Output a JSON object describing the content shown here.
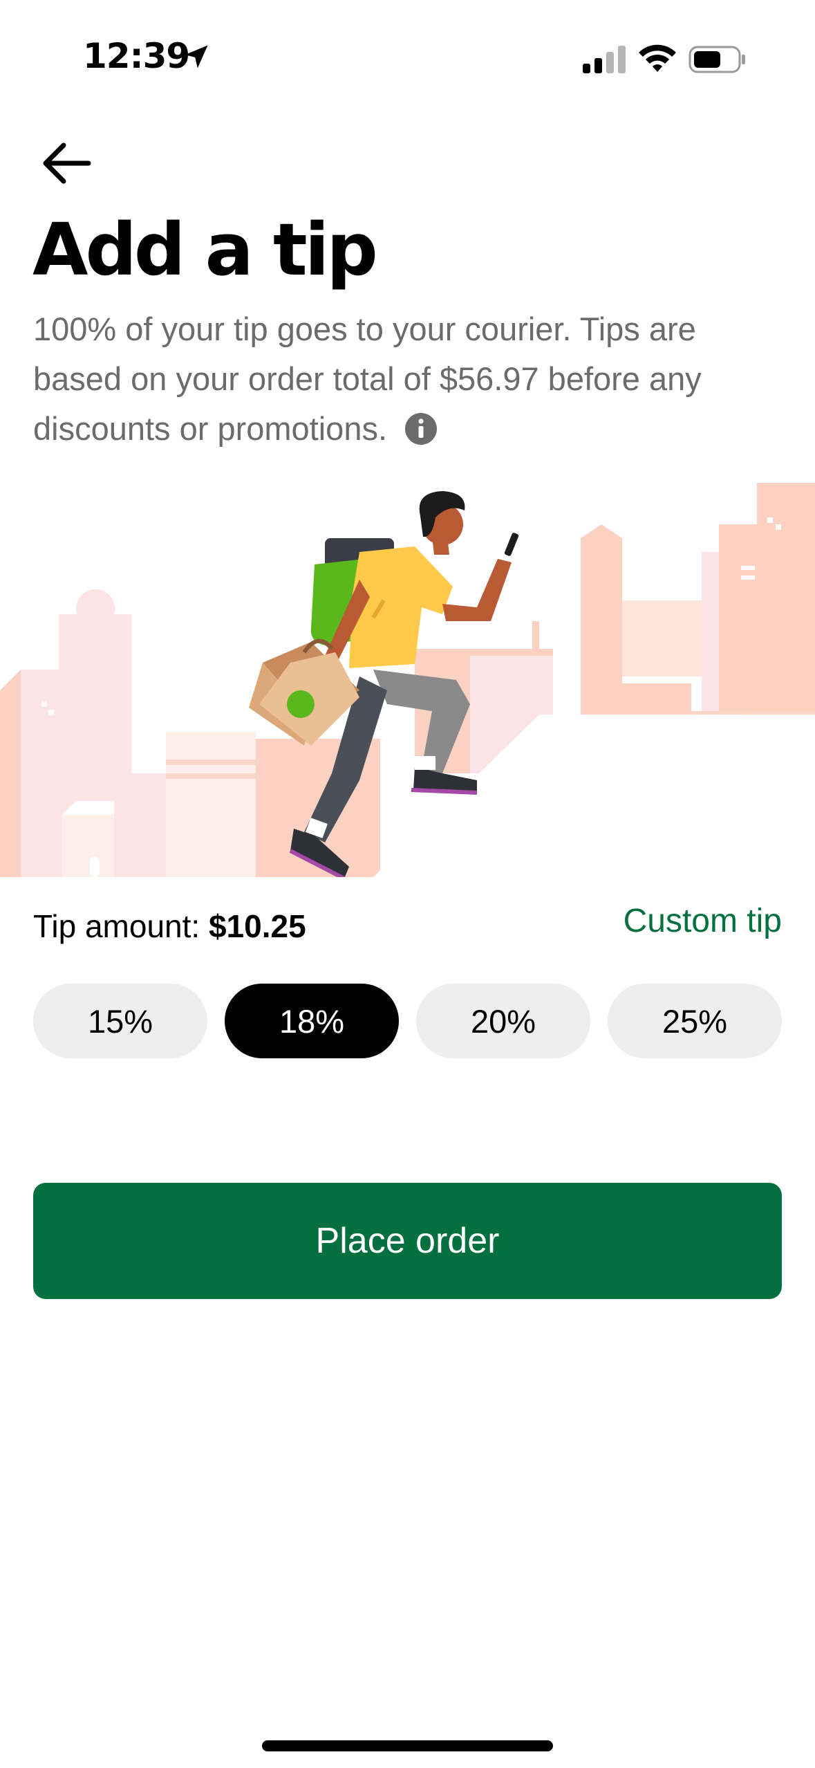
{
  "status_bar": {
    "time": "12:39"
  },
  "header": {
    "title": "Add a tip"
  },
  "description": {
    "text": "100% of your tip goes to your courier. Tips are based on your order total of $56.97 before any discounts or promotions."
  },
  "tip": {
    "amount_label": "Tip amount: ",
    "amount_value": "$10.25",
    "custom_tip_label": "Custom tip",
    "options": [
      {
        "label": "15%",
        "selected": false
      },
      {
        "label": "18%",
        "selected": true
      },
      {
        "label": "20%",
        "selected": false
      },
      {
        "label": "25%",
        "selected": false
      }
    ]
  },
  "actions": {
    "place_order_label": "Place order"
  },
  "colors": {
    "accent_green": "#05703f",
    "selected_chip": "#000000",
    "chip_bg": "#eeeeee",
    "secondary_text": "#6b6b6b"
  },
  "icons": [
    "location-arrow-icon",
    "signal-icon",
    "wifi-icon",
    "battery-icon",
    "back-arrow-icon",
    "info-icon"
  ]
}
